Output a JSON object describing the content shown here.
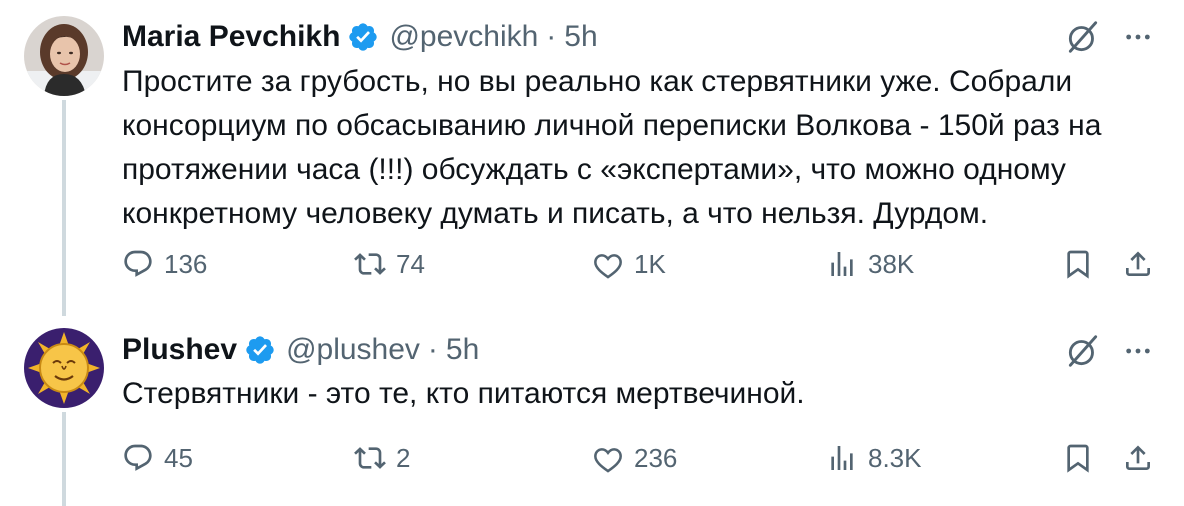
{
  "tweets": [
    {
      "author_name": "Maria Pevchikh",
      "handle": "@pevchikh",
      "separator": "·",
      "time": "5h",
      "text": "Простите за грубость, но вы реально как стервятники уже. Собрали консорциум по обсасыванию личной переписки Волкова - 150й раз на протяжении часа (!!!) обсуждать с «экспертами», что можно одному конкретному человеку думать и писать, а что нельзя. Дурдом.",
      "replies": "136",
      "retweets": "74",
      "likes": "1K",
      "views": "38K",
      "avatar_icon": "profile-photo"
    },
    {
      "author_name": "Plushev",
      "handle": "@plushev",
      "separator": "·",
      "time": "5h",
      "text": "Стервятники - это те, кто питаются мертвечиной.",
      "replies": "45",
      "retweets": "2",
      "likes": "236",
      "views": "8.3K",
      "avatar_icon": "sun-face-avatar"
    }
  ],
  "colors": {
    "verified": "#1d9bf0",
    "secondary_text": "#536471",
    "primary_text": "#0f1419",
    "thread_line": "#cfd9de"
  },
  "icons": [
    "verified-badge-icon",
    "grok-icon",
    "more-icon",
    "reply-icon",
    "retweet-icon",
    "like-icon",
    "views-icon",
    "bookmark-icon",
    "share-icon"
  ]
}
